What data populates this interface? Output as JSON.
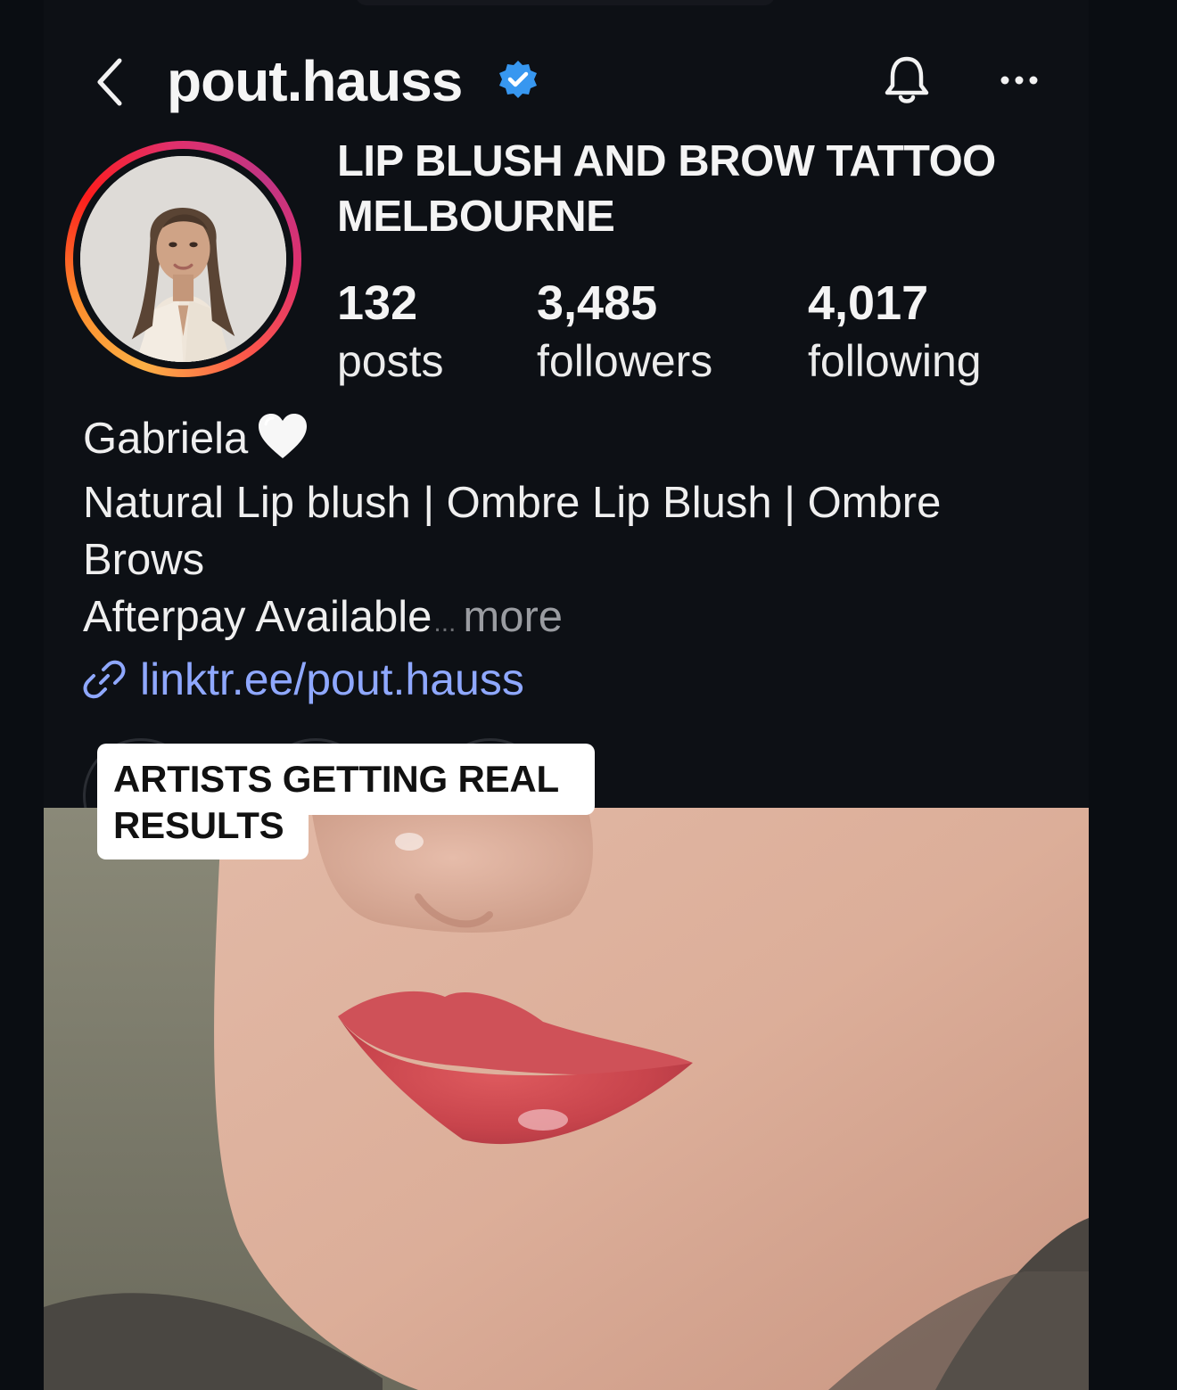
{
  "header": {
    "back_icon": "chevron-left-icon",
    "username": "pout.hauss",
    "verified_icon": "verified-badge-icon",
    "bell_icon": "bell-icon",
    "more_icon": "ellipsis-icon"
  },
  "profile": {
    "category": "LIP BLUSH AND BROW TATTOO MELBOURNE",
    "avatar_ring_colors": [
      "#fcb045",
      "#fd1d1d",
      "#e1306c",
      "#c13584"
    ],
    "stats": [
      {
        "value": "132",
        "label": "posts"
      },
      {
        "value": "3,485",
        "label": "followers"
      },
      {
        "value": "4,017",
        "label": "following"
      }
    ]
  },
  "bio": {
    "name": "Gabriela",
    "heart_icon": "white-heart-icon",
    "line1": "Natural Lip blush | Ombre Lip Blush | Ombre Brows",
    "line2": "Afterpay Available",
    "ellipsis": "...",
    "more": "more",
    "link_icon": "link-icon",
    "link": "linktr.ee/pout.hauss",
    "link_color": "#8fa8ff"
  },
  "overlay_caption": "ARTISTS GETTING REAL RESULTS",
  "colors": {
    "background": "#0d1015",
    "verified_blue": "#3797f0",
    "text": "#f4f4f4",
    "muted": "#9a9ca1"
  }
}
